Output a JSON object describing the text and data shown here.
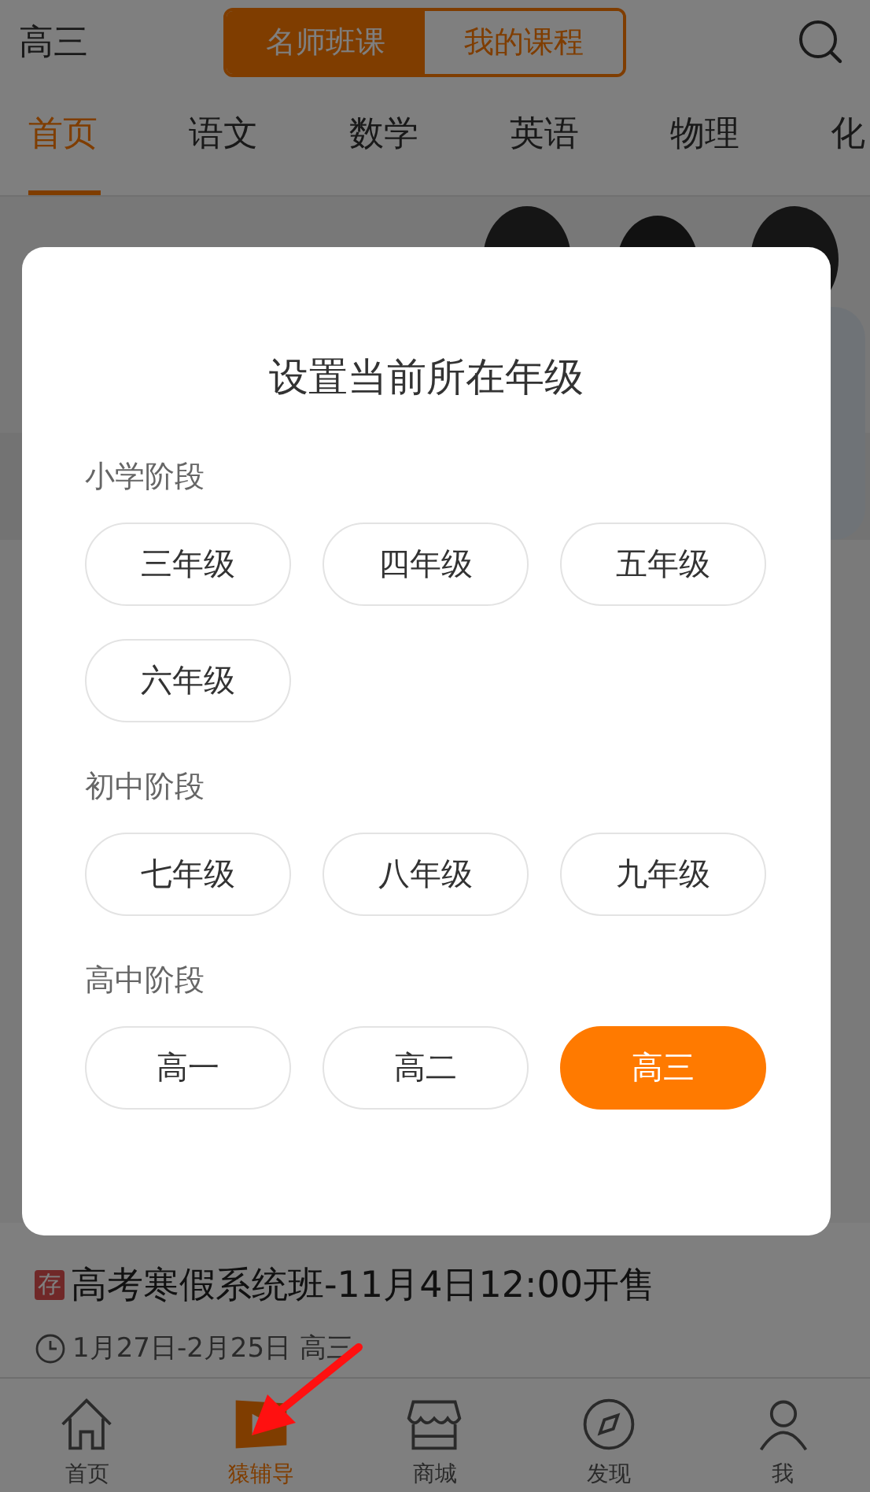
{
  "header": {
    "grade": "高三",
    "segments": [
      {
        "label": "名师班课",
        "selected": true
      },
      {
        "label": "我的课程",
        "selected": false
      }
    ]
  },
  "subject_tabs": [
    {
      "label": "首页",
      "selected": true
    },
    {
      "label": "语文",
      "selected": false
    },
    {
      "label": "数学",
      "selected": false
    },
    {
      "label": "英语",
      "selected": false
    },
    {
      "label": "物理",
      "selected": false
    },
    {
      "label": "化",
      "selected": false
    }
  ],
  "course": {
    "badge": "存",
    "title": "高考寒假系统班-11月4日12:00开售",
    "schedule": "1月27日-2月25日 高三"
  },
  "bottom_nav": [
    {
      "label": "首页",
      "kind": "home",
      "selected": false
    },
    {
      "label": "猿辅导",
      "kind": "video",
      "selected": true
    },
    {
      "label": "商城",
      "kind": "store",
      "selected": false
    },
    {
      "label": "发现",
      "kind": "discover",
      "selected": false
    },
    {
      "label": "我",
      "kind": "person",
      "selected": false
    }
  ],
  "dialog": {
    "title": "设置当前所在年级",
    "sections": [
      {
        "heading": "小学阶段",
        "grades": [
          {
            "label": "三年级",
            "selected": false
          },
          {
            "label": "四年级",
            "selected": false
          },
          {
            "label": "五年级",
            "selected": false
          },
          {
            "label": "六年级",
            "selected": false
          }
        ]
      },
      {
        "heading": "初中阶段",
        "grades": [
          {
            "label": "七年级",
            "selected": false
          },
          {
            "label": "八年级",
            "selected": false
          },
          {
            "label": "九年级",
            "selected": false
          }
        ]
      },
      {
        "heading": "高中阶段",
        "grades": [
          {
            "label": "高一",
            "selected": false
          },
          {
            "label": "高二",
            "selected": false
          },
          {
            "label": "高三",
            "selected": true
          }
        ]
      }
    ]
  }
}
